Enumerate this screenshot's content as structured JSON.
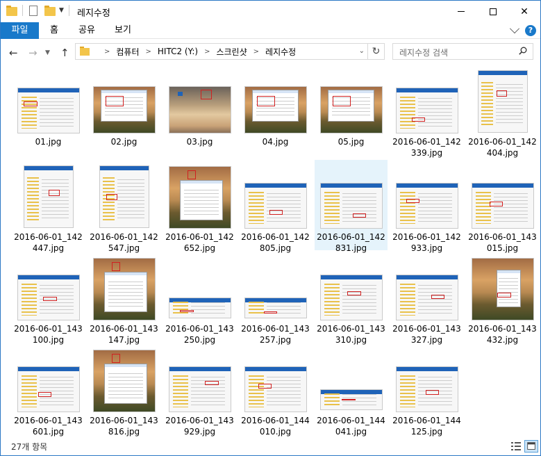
{
  "window": {
    "title": "레지수정",
    "controls": {
      "minimize": "—",
      "maximize": "☐",
      "close": "✕"
    }
  },
  "ribbon": {
    "tabs": [
      {
        "label": "파일",
        "active": true
      },
      {
        "label": "홈"
      },
      {
        "label": "공유"
      },
      {
        "label": "보기"
      }
    ],
    "help": "?"
  },
  "nav": {
    "back": "←",
    "forward": "→",
    "recent": "⌄",
    "up": "↑",
    "refresh": "↻"
  },
  "address": {
    "crumbs": [
      "컴퓨터",
      "HITC2 (Y:)",
      "스크린샷",
      "레지수정"
    ]
  },
  "search": {
    "placeholder": "레지수정 검색"
  },
  "items": [
    {
      "name": "01.jpg",
      "thumb": "white-dialog"
    },
    {
      "name": "02.jpg",
      "thumb": "desktop"
    },
    {
      "name": "03.jpg",
      "thumb": "sky"
    },
    {
      "name": "04.jpg",
      "thumb": "desktop"
    },
    {
      "name": "05.jpg",
      "thumb": "desktop"
    },
    {
      "name": "2016-06-01_142339.jpg",
      "thumb": "white-dialog"
    },
    {
      "name": "2016-06-01_142404.jpg",
      "thumb": "white-tall"
    },
    {
      "name": "2016-06-01_142447.jpg",
      "thumb": "white-tall"
    },
    {
      "name": "2016-06-01_142547.jpg",
      "thumb": "white-tall"
    },
    {
      "name": "2016-06-01_142652.jpg",
      "thumb": "desktop-window"
    },
    {
      "name": "2016-06-01_142805.jpg",
      "thumb": "white-dialog"
    },
    {
      "name": "2016-06-01_142831.jpg",
      "thumb": "white-dialog",
      "selected": true
    },
    {
      "name": "2016-06-01_142933.jpg",
      "thumb": "white-dialog"
    },
    {
      "name": "2016-06-01_143015.jpg",
      "thumb": "white-dialog"
    },
    {
      "name": "2016-06-01_143100.jpg",
      "thumb": "white-dialog"
    },
    {
      "name": "2016-06-01_143147.jpg",
      "thumb": "desktop-window"
    },
    {
      "name": "2016-06-01_143250.jpg",
      "thumb": "white-small"
    },
    {
      "name": "2016-06-01_143257.jpg",
      "thumb": "white-small"
    },
    {
      "name": "2016-06-01_143310.jpg",
      "thumb": "white-dialog"
    },
    {
      "name": "2016-06-01_143327.jpg",
      "thumb": "white-dialog"
    },
    {
      "name": "2016-06-01_143432.jpg",
      "thumb": "desktop-menu"
    },
    {
      "name": "2016-06-01_143601.jpg",
      "thumb": "white-dialog"
    },
    {
      "name": "2016-06-01_143816.jpg",
      "thumb": "desktop-window"
    },
    {
      "name": "2016-06-01_143929.jpg",
      "thumb": "white-dialog"
    },
    {
      "name": "2016-06-01_144010.jpg",
      "thumb": "white-dialog"
    },
    {
      "name": "2016-06-01_144041.jpg",
      "thumb": "white-small"
    },
    {
      "name": "2016-06-01_144125.jpg",
      "thumb": "white-dialog"
    }
  ],
  "status": {
    "count_text": "27개 항목"
  }
}
